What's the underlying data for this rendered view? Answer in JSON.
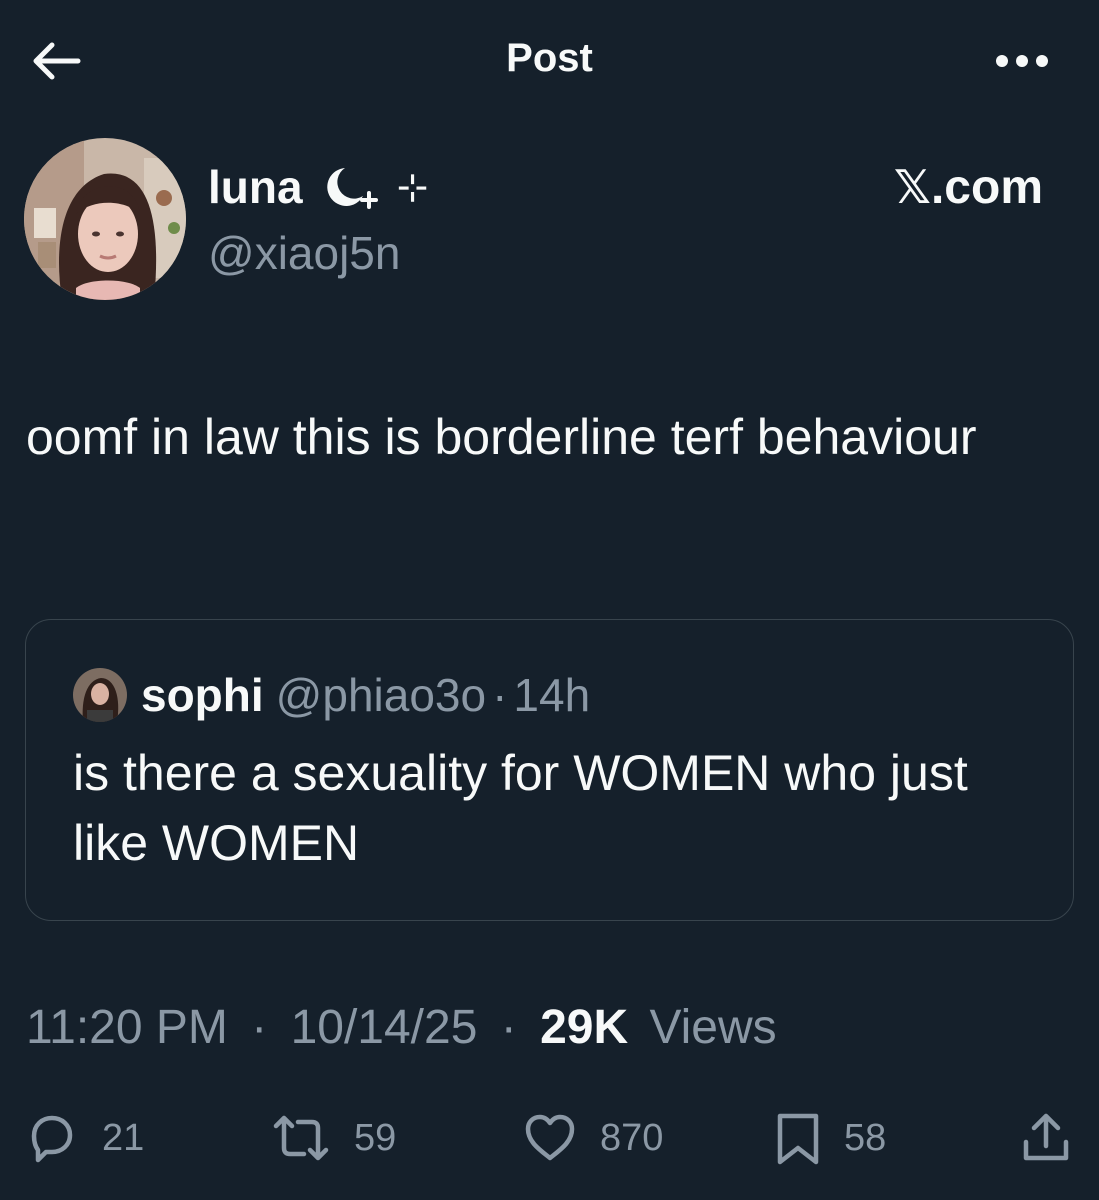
{
  "header": {
    "title": "Post",
    "back_icon": "arrow-left-icon",
    "more_icon": "ellipsis-icon"
  },
  "author": {
    "display_name": "luna",
    "name_decoration": "⊹",
    "handle": "@xiaoj5n",
    "avatar": "avatar-photo",
    "moon_icon": "crescent-moon-icon"
  },
  "watermark": {
    "logo_letter": "𝕏",
    "text": ".com"
  },
  "tweet": {
    "text": "oomf in law this is borderline terf behaviour"
  },
  "quote": {
    "name": "sophi",
    "handle": "@phiao3o",
    "separator": "·",
    "time": "14h",
    "text": "is there a sexuality for WOMEN who just like WOMEN"
  },
  "meta": {
    "time": "11:20 PM",
    "date": "10/14/25",
    "views_count": "29K",
    "views_label": "Views",
    "separator": "·"
  },
  "actions": {
    "replies": "21",
    "reposts": "59",
    "likes": "870",
    "bookmarks": "58"
  },
  "colors": {
    "background": "#15202b",
    "text": "#f7f9f9",
    "muted": "#8b98a5",
    "border": "#38444d"
  }
}
